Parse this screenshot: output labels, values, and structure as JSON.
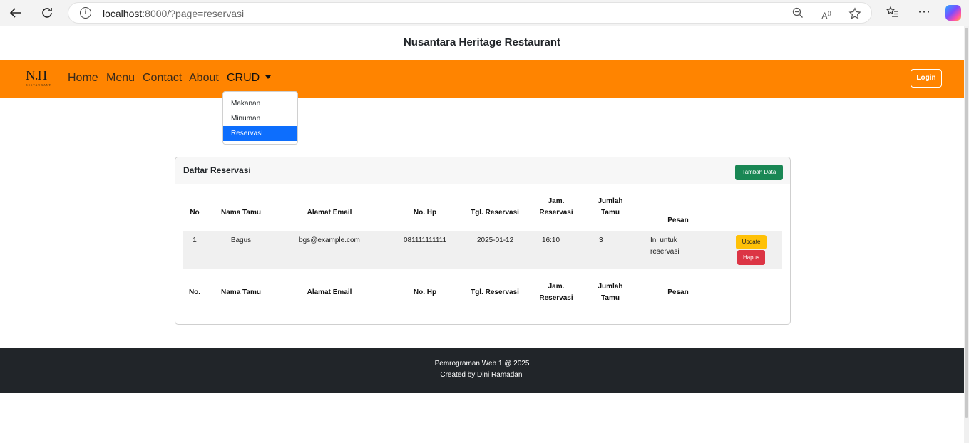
{
  "browser": {
    "url_host": "localhost",
    "url_rest": ":8000/?page=reservasi",
    "info_icon": "info-icon"
  },
  "site": {
    "title": "Nusantara Heritage Restaurant",
    "logo_mark": "N.H",
    "logo_sub": "RESTAURANT",
    "brand_color": "#ff8400"
  },
  "nav": {
    "home": "Home",
    "menu": "Menu",
    "contact": "Contact",
    "about": "About",
    "crud": "CRUD",
    "login": "Login"
  },
  "dropdown": {
    "items": [
      "Makanan",
      "Minuman",
      "Reservasi"
    ],
    "active": "Reservasi"
  },
  "card": {
    "title": "Daftar Reservasi",
    "add_button": "Tambah Data"
  },
  "table": {
    "headers": {
      "no": "No",
      "nama": "Nama Tamu",
      "email": "Alamat Email",
      "hp": "No. Hp",
      "tgl": "Tgl. Reservasi",
      "jam": "Jam. Reservasi",
      "jumlah": "Jumlah Tamu",
      "pesan": "Pesan"
    },
    "footer_headers": {
      "no": "No.",
      "nama": "Nama Tamu",
      "email": "Alamat Email",
      "hp": "No. Hp",
      "tgl": "Tgl. Reservasi",
      "jam": "Jam. Reservasi",
      "jumlah": "Jumlah Tamu",
      "pesan": "Pesan"
    },
    "rows": [
      {
        "no": "1",
        "nama": "Bagus",
        "email": "bgs@example.com",
        "hp": "081111111111",
        "tgl": "2025-01-12",
        "jam": "16:10",
        "jumlah": "3",
        "pesan": "Ini untuk reservasi",
        "update": "Update",
        "hapus": "Hapus"
      }
    ]
  },
  "footer": {
    "line1": "Pemrograman Web 1 @ 2025",
    "line2": "Created by Dini Ramadani"
  }
}
